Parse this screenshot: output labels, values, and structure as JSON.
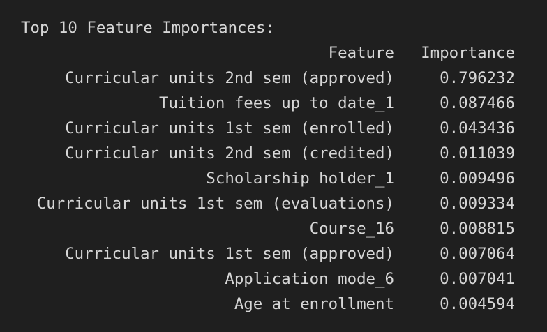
{
  "output": {
    "title": "Top 10 Feature Importances:",
    "columns": {
      "feature": "Feature",
      "importance": "Importance"
    },
    "rows": [
      {
        "feature": "Curricular units 2nd sem (approved)",
        "importance": "0.796232"
      },
      {
        "feature": "Tuition fees up to date_1",
        "importance": "0.087466"
      },
      {
        "feature": "Curricular units 1st sem (enrolled)",
        "importance": "0.043436"
      },
      {
        "feature": "Curricular units 2nd sem (credited)",
        "importance": "0.011039"
      },
      {
        "feature": "Scholarship holder_1",
        "importance": "0.009496"
      },
      {
        "feature": "Curricular units 1st sem (evaluations)",
        "importance": "0.009334"
      },
      {
        "feature": "Course_16",
        "importance": "0.008815"
      },
      {
        "feature": "Curricular units 1st sem (approved)",
        "importance": "0.007064"
      },
      {
        "feature": "Application mode_6",
        "importance": "0.007041"
      },
      {
        "feature": "Age at enrollment",
        "importance": "0.004594"
      }
    ]
  },
  "colors": {
    "background": "#1f1f1f",
    "text": "#d6d6d6"
  }
}
